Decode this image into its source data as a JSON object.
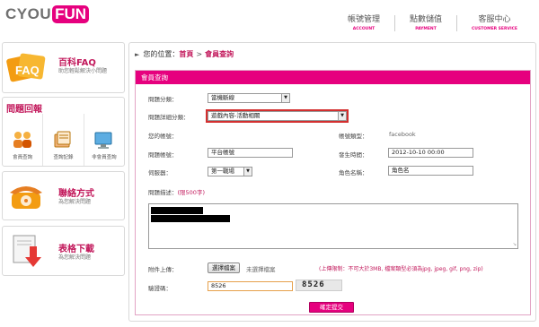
{
  "brand": {
    "logo_left": "CYOU",
    "logo_right": "FUN"
  },
  "topnav": [
    {
      "zh": "帳號管理",
      "en": "ACCOUNT"
    },
    {
      "zh": "點數儲值",
      "en": "PAYMENT"
    },
    {
      "zh": "客服中心",
      "en": "CUSTOMER SERVICE"
    }
  ],
  "sidebar": {
    "faq": {
      "title": "百科FAQ",
      "sub": "助您輕鬆解決小問題"
    },
    "report": {
      "title": "問題回報",
      "items": [
        {
          "label": "會員查詢"
        },
        {
          "label": "查詢記錄"
        },
        {
          "label": "非會員查詢"
        }
      ]
    },
    "contact": {
      "title": "聯絡方式",
      "sub": "為您解決問題"
    },
    "download": {
      "title": "表格下載",
      "sub": "為您解決問題"
    }
  },
  "breadcrumb": {
    "prefix": "您的位置：",
    "home": "首頁",
    "sep": ">",
    "current": "會員查詢"
  },
  "form": {
    "header": "會員查詢",
    "category_label": "問題分類：",
    "category_value": "當機斷線",
    "subcategory_label": "問題詳細分類：",
    "subcategory_value": "遊戲內容-活動相關",
    "account_label": "您的帳號：",
    "account_type_label": "帳號類型：",
    "account_type_value": "facebook",
    "issue_account_label": "問題帳號：",
    "issue_account_value": "平台帳號",
    "time_label": "發生時間：",
    "time_value": "2012-10-10 00:00",
    "server_label": "伺服器：",
    "server_value": "第一戰場",
    "role_label": "角色名稱：",
    "role_value": "角色名",
    "desc_label": "問題描述：",
    "desc_limit": "(限500字)",
    "attach_label": "附件上傳：",
    "file_button": "選擇檔案",
    "file_status": "未選擇檔案",
    "file_note": "(上傳限制：不可大於3MB, 檔案類型必須為jpg, jpeg, gif, png, zip)",
    "captcha_label": "驗證碼：",
    "captcha_input": "8526",
    "captcha_image": "8526",
    "submit_label": "確定提交"
  },
  "colors": {
    "accent": "#e6007e",
    "link": "#c2185b"
  }
}
